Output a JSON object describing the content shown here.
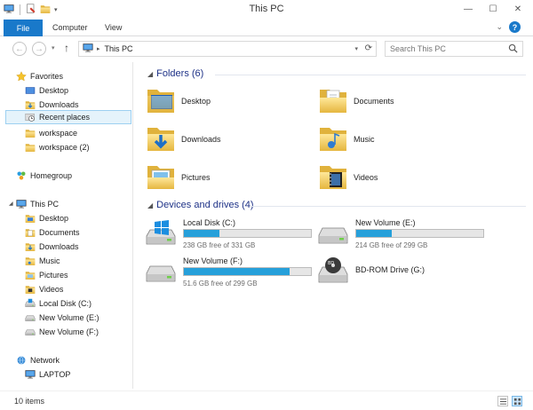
{
  "window": {
    "title": "This PC",
    "controls": {
      "minimize": "—",
      "maximize": "☐",
      "close": "✕"
    }
  },
  "ribbon": {
    "file": "File",
    "tabs": [
      "Computer",
      "View"
    ],
    "help": "?",
    "expand": "⌄"
  },
  "nav": {
    "back": "←",
    "forward": "→",
    "up": "↑",
    "crumb_separator": "▸",
    "crumb": "This PC",
    "search_placeholder": "Search This PC"
  },
  "sidebar": {
    "favorites": {
      "label": "Favorites",
      "items": [
        "Desktop",
        "Downloads",
        "Recent places",
        "workspace",
        "workspace (2)"
      ]
    },
    "homegroup": {
      "label": "Homegroup"
    },
    "thispc": {
      "label": "This PC",
      "items": [
        "Desktop",
        "Documents",
        "Downloads",
        "Music",
        "Pictures",
        "Videos",
        "Local Disk (C:)",
        "New Volume (E:)",
        "New Volume (F:)"
      ]
    },
    "network": {
      "label": "Network",
      "items": [
        "LAPTOP"
      ]
    }
  },
  "content": {
    "folders_header": "Folders (6)",
    "folders": [
      "Desktop",
      "Documents",
      "Downloads",
      "Music",
      "Pictures",
      "Videos"
    ],
    "drives_header": "Devices and drives (4)",
    "drives": [
      {
        "name": "Local Disk (C:)",
        "free": "238 GB free of 331 GB",
        "used_fraction": 0.28
      },
      {
        "name": "New Volume (E:)",
        "free": "214 GB free of 299 GB",
        "used_fraction": 0.28
      },
      {
        "name": "New Volume (F:)",
        "free": "51.6 GB free of 299 GB",
        "used_fraction": 0.83
      },
      {
        "name": "BD-ROM Drive (G:)"
      }
    ]
  },
  "status": {
    "items": "10 items"
  },
  "colors": {
    "accent": "#1979ca",
    "drive_fill": "#26a0da",
    "group_header": "#1e3287",
    "selection": "#e5f3fb"
  }
}
